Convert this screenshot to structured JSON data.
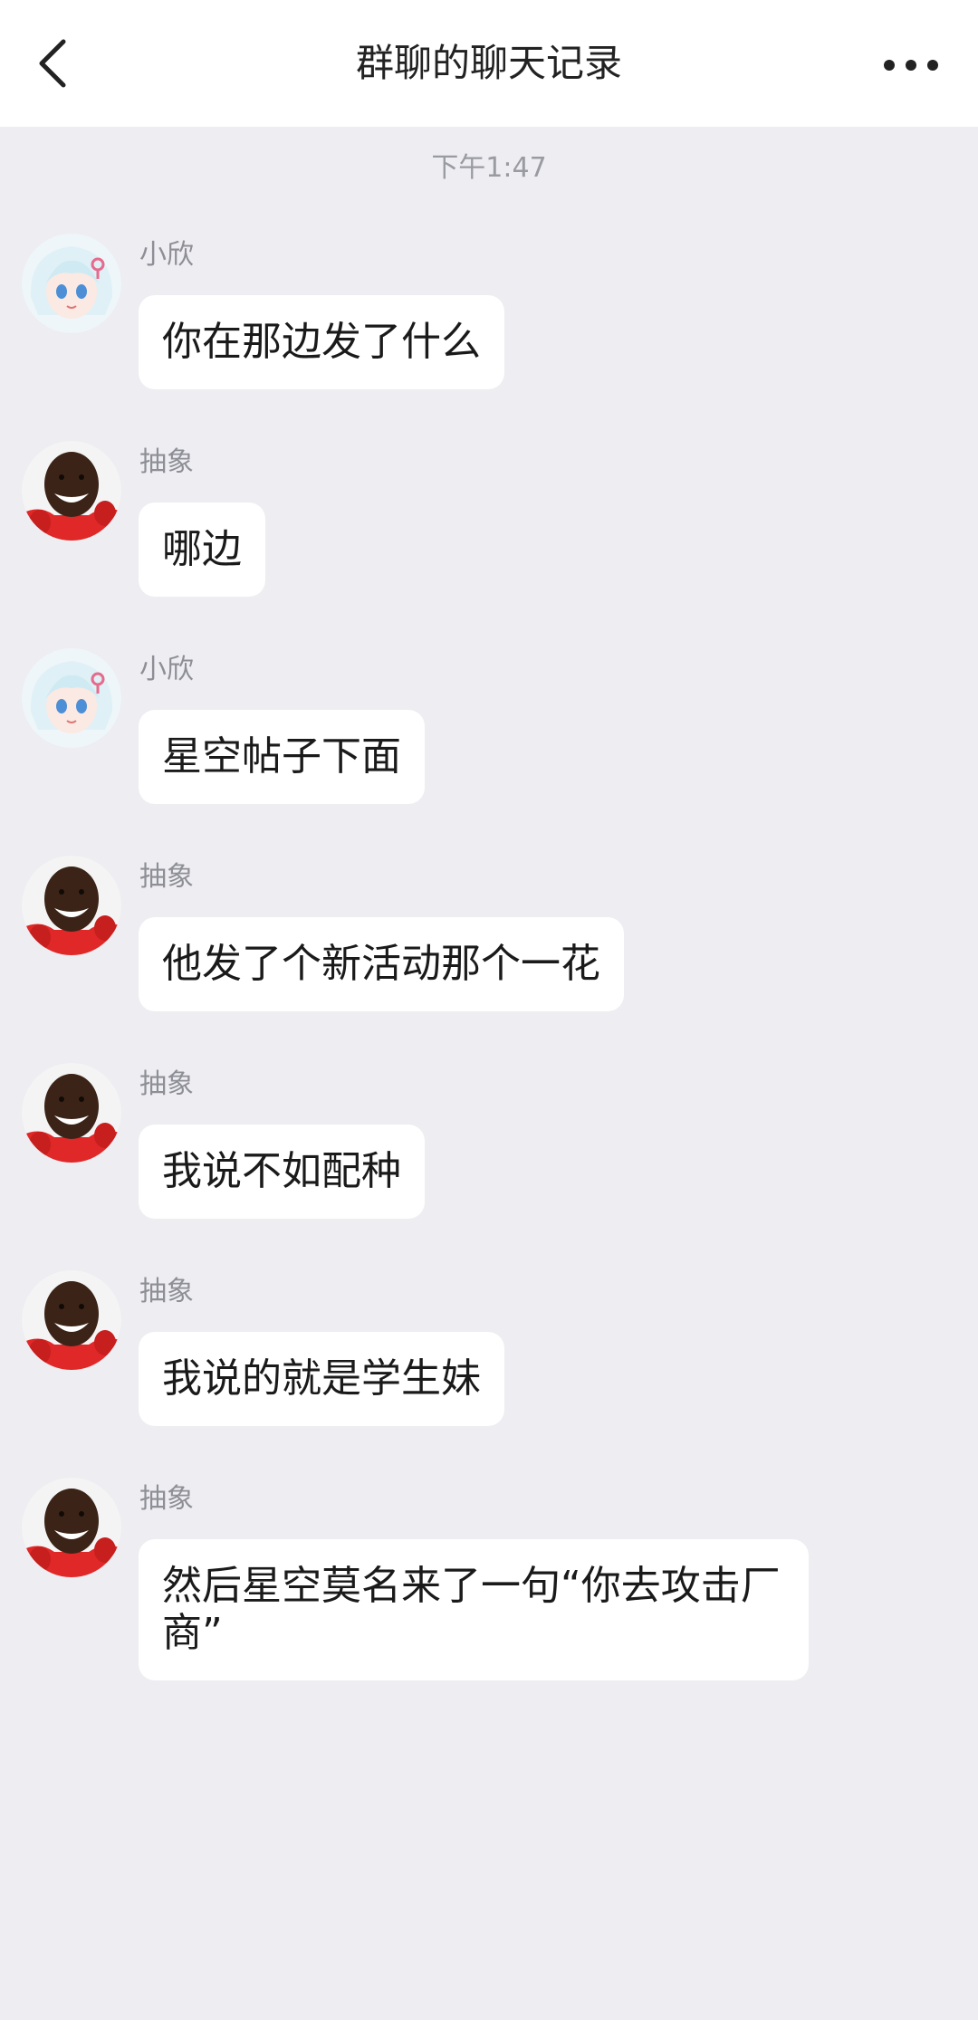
{
  "header": {
    "title": "群聊的聊天记录",
    "back_icon": "chevron-left-icon",
    "more_icon": "more-horizontal-icon"
  },
  "timestamp": "下午1:47",
  "messages": [
    {
      "sender": "小欣",
      "avatar": "anime-girl-avatar",
      "text": "你在那边发了什么"
    },
    {
      "sender": "抽象",
      "avatar": "smiling-man-avatar",
      "text": "哪边"
    },
    {
      "sender": "小欣",
      "avatar": "anime-girl-avatar",
      "text": "星空帖子下面"
    },
    {
      "sender": "抽象",
      "avatar": "smiling-man-avatar",
      "text": "他发了个新活动那个一花"
    },
    {
      "sender": "抽象",
      "avatar": "smiling-man-avatar",
      "text": "我说不如配种"
    },
    {
      "sender": "抽象",
      "avatar": "smiling-man-avatar",
      "text": "我说的就是学生妹"
    },
    {
      "sender": "抽象",
      "avatar": "smiling-man-avatar",
      "text": "然后星空莫名来了一句“你去攻击厂商”"
    }
  ],
  "colors": {
    "background": "#ededf2",
    "header": "#ffffff",
    "bubble": "#ffffff",
    "text": "#1a1a1a",
    "meta": "#8e8e96"
  }
}
